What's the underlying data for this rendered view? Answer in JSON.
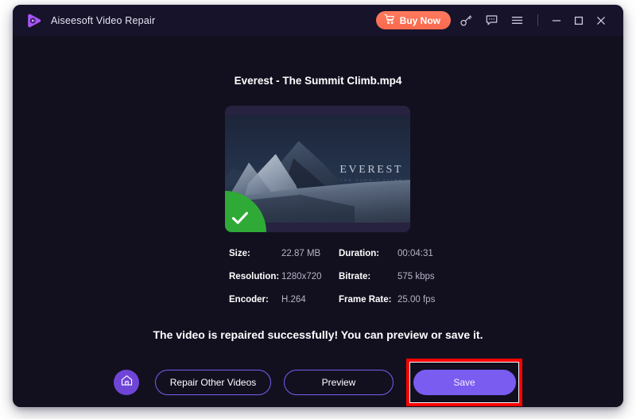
{
  "window": {
    "app_title": "Aiseesoft Video Repair",
    "logo_icon": "play-logo-icon"
  },
  "titlebar": {
    "buy_now_label": "Buy Now",
    "cart_icon": "shopping-cart-icon",
    "key_icon": "key-icon",
    "feedback_icon": "speech-bubble-icon",
    "menu_icon": "hamburger-menu-icon",
    "minimize_icon": "minimize-icon",
    "maximize_icon": "maximize-icon",
    "close_icon": "close-icon"
  },
  "main": {
    "file_name": "Everest - The Summit Climb.mp4",
    "thumbnail": {
      "overlay_title": "EVEREST",
      "overlay_subtitle": "THE SUMMIT CLIMB",
      "badge_icon": "green-check-badge-icon"
    },
    "metadata": [
      {
        "label": "Size:",
        "value": "22.87 MB"
      },
      {
        "label": "Duration:",
        "value": "00:04:31"
      },
      {
        "label": "Resolution:",
        "value": "1280x720"
      },
      {
        "label": "Bitrate:",
        "value": "575 kbps"
      },
      {
        "label": "Encoder:",
        "value": "H.264"
      },
      {
        "label": "Frame Rate:",
        "value": "25.00 fps"
      }
    ],
    "status_message": "The video is repaired successfully! You can preview or save it.",
    "actions": {
      "home_icon": "home-icon",
      "repair_other_videos_label": "Repair Other Videos",
      "preview_label": "Preview",
      "save_label": "Save"
    }
  },
  "colors": {
    "window_background": "#12101f",
    "titlebar_background": "#16132a",
    "accent_purple": "#7b5cf0",
    "buy_now_orange": "#f96a4e",
    "success_green": "#2faa37",
    "highlight_red": "#fe0000"
  }
}
